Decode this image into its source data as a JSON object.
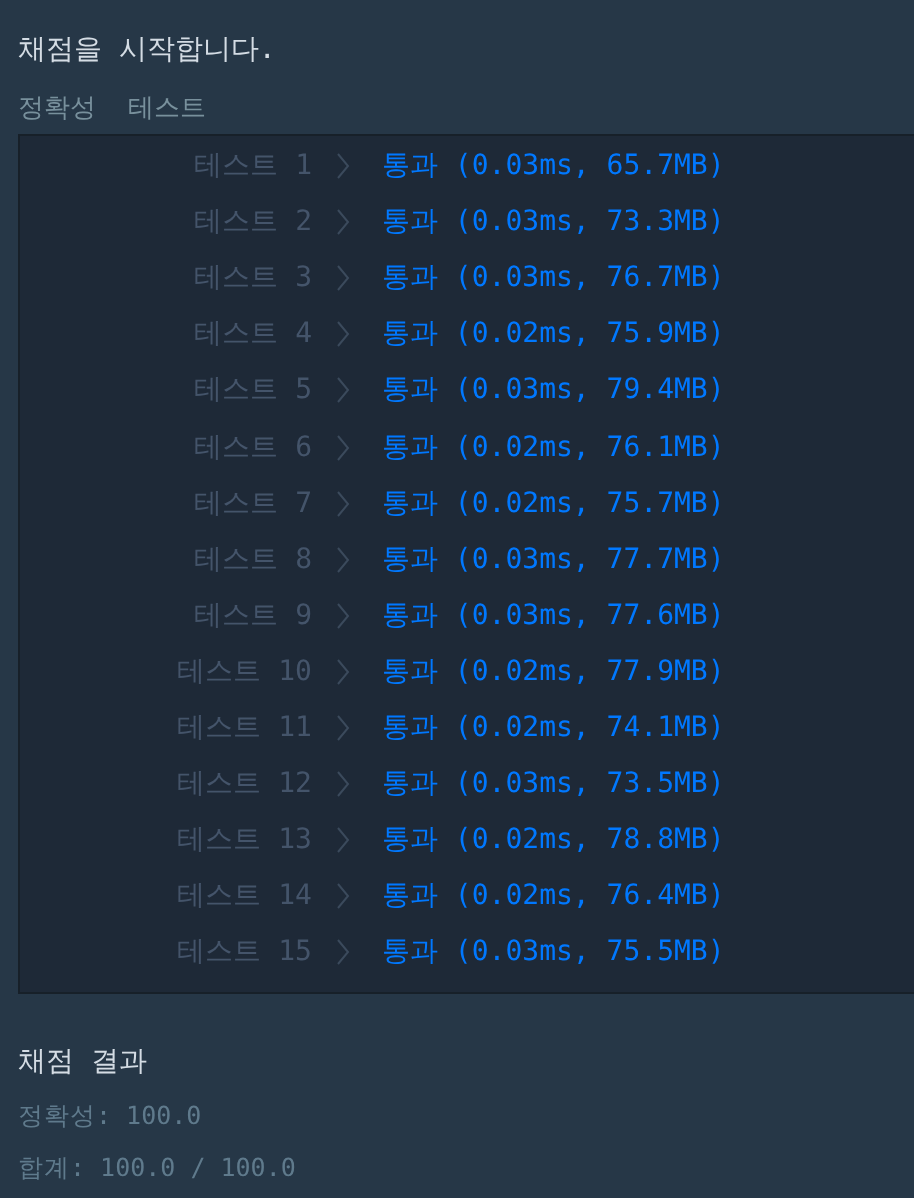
{
  "heading": "채점을 시작합니다.",
  "tabs": [
    {
      "label": "정확성"
    },
    {
      "label": "테스트"
    }
  ],
  "tests": [
    {
      "label": "테스트 1",
      "result": "통과 (0.03ms, 65.7MB)"
    },
    {
      "label": "테스트 2",
      "result": "통과 (0.03ms, 73.3MB)"
    },
    {
      "label": "테스트 3",
      "result": "통과 (0.03ms, 76.7MB)"
    },
    {
      "label": "테스트 4",
      "result": "통과 (0.02ms, 75.9MB)"
    },
    {
      "label": "테스트 5",
      "result": "통과 (0.03ms, 79.4MB)"
    },
    {
      "label": "테스트 6",
      "result": "통과 (0.02ms, 76.1MB)"
    },
    {
      "label": "테스트 7",
      "result": "통과 (0.02ms, 75.7MB)"
    },
    {
      "label": "테스트 8",
      "result": "통과 (0.03ms, 77.7MB)"
    },
    {
      "label": "테스트 9",
      "result": "통과 (0.03ms, 77.6MB)"
    },
    {
      "label": "테스트 10",
      "result": "통과 (0.02ms, 77.9MB)"
    },
    {
      "label": "테스트 11",
      "result": "통과 (0.02ms, 74.1MB)"
    },
    {
      "label": "테스트 12",
      "result": "통과 (0.03ms, 73.5MB)"
    },
    {
      "label": "테스트 13",
      "result": "통과 (0.02ms, 78.8MB)"
    },
    {
      "label": "테스트 14",
      "result": "통과 (0.02ms, 76.4MB)"
    },
    {
      "label": "테스트 15",
      "result": "통과 (0.03ms, 75.5MB)"
    }
  ],
  "summary": {
    "title": "채점 결과",
    "lines": [
      "정확성: 100.0",
      "합계: 100.0 / 100.0"
    ]
  }
}
